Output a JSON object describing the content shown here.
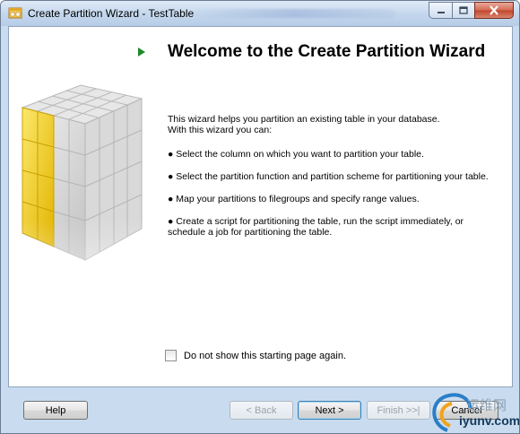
{
  "window": {
    "title": "Create Partition Wizard - TestTable"
  },
  "page": {
    "heading": "Welcome to the Create Partition Wizard",
    "intro_line1": "This wizard helps you partition an existing table in your database.",
    "intro_line2": "With this wizard you can:",
    "bullets": [
      "● Select the column on which you want to partition your table.",
      "● Select the partition function and partition scheme for partitioning your table.",
      "● Map your partitions to filegroups and specify range values.",
      "● Create a script for partitioning the table, run the script immediately, or schedule a job for partitioning the table."
    ],
    "checkbox_label": "Do not show this starting page again.",
    "checkbox_checked": false
  },
  "buttons": {
    "help": "Help",
    "back": "< Back",
    "next": "Next >",
    "finish": "Finish >>|",
    "cancel": "Cancel"
  },
  "watermark": {
    "text_cn": "运维网",
    "url": "iyunv.com"
  },
  "colors": {
    "frame": "#c9dcef",
    "cube_highlight": "#f2d31b",
    "cube_grey": "#d8d8d8",
    "play_arrow": "#1f8a2a",
    "close_button": "#c8553e"
  }
}
